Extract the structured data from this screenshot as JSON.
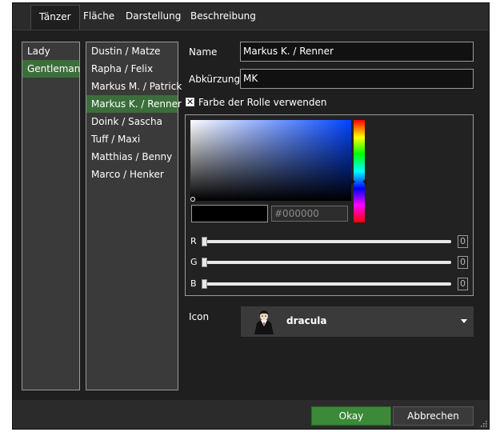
{
  "tabs": [
    {
      "label": "Tänzer",
      "active": true
    },
    {
      "label": "Fläche",
      "active": false
    },
    {
      "label": "Darstellung",
      "active": false
    },
    {
      "label": "Beschreibung",
      "active": false
    }
  ],
  "roles": [
    {
      "label": "Lady",
      "selected": false
    },
    {
      "label": "Gentleman",
      "selected": true
    }
  ],
  "dancers": [
    {
      "label": "Dustin / Matze",
      "selected": false
    },
    {
      "label": "Rapha / Felix",
      "selected": false
    },
    {
      "label": "Markus M. / Patrick",
      "selected": false
    },
    {
      "label": "Markus K. / Renner",
      "selected": true
    },
    {
      "label": "Doink / Sascha",
      "selected": false
    },
    {
      "label": "Tuff / Maxi",
      "selected": false
    },
    {
      "label": "Matthias / Benny",
      "selected": false
    },
    {
      "label": "Marco / Henker",
      "selected": false
    }
  ],
  "form": {
    "name_label": "Name",
    "name_value": "Markus K. / Renner",
    "abbr_label": "Abkürzung",
    "abbr_value": "MK",
    "use_role_color_label": "Farbe der Rolle verwenden",
    "use_role_color_checked": true,
    "check_glyph": "✕"
  },
  "color_picker": {
    "hex": "#000000",
    "r_label": "R",
    "r_value": "0",
    "g_label": "G",
    "g_value": "0",
    "b_label": "B",
    "b_value": "0",
    "preview_color": "#000000"
  },
  "icon": {
    "label": "Icon",
    "value": "dracula",
    "icon_name": "dracula-avatar-icon"
  },
  "buttons": {
    "ok": "Okay",
    "cancel": "Abbrechen"
  },
  "colors": {
    "accent_green": "#3c8a38",
    "selection_green": "#3c6e3c",
    "background": "#1f1f1f"
  }
}
